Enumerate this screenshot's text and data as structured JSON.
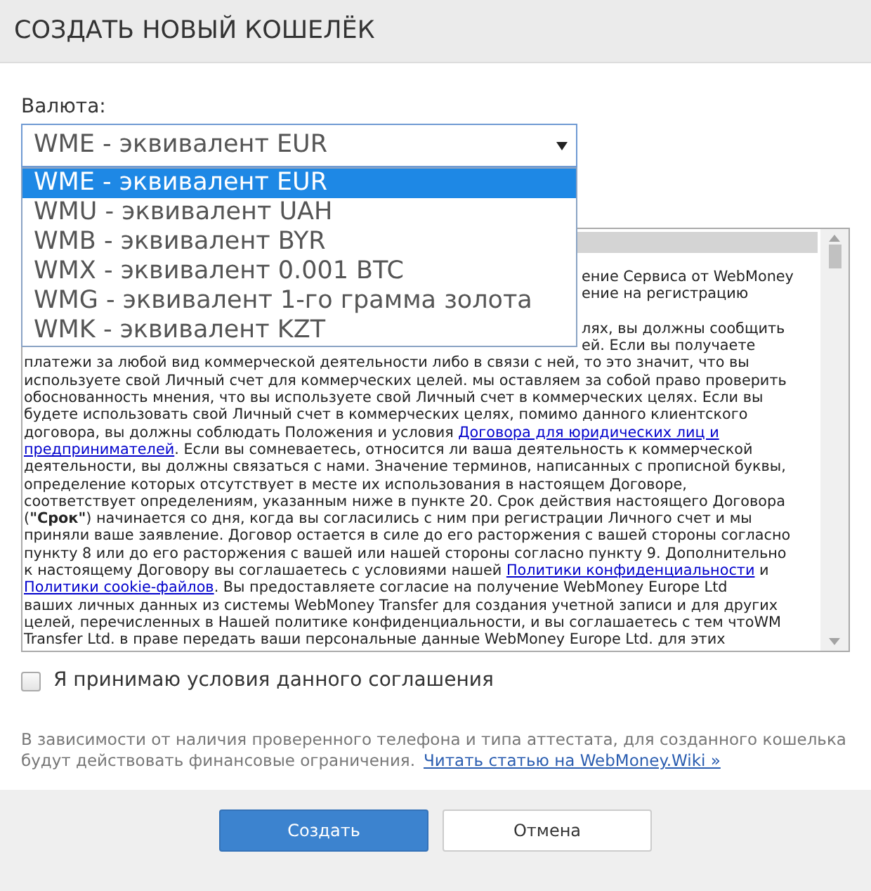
{
  "dialog": {
    "title": "СОЗДАТЬ НОВЫЙ КОШЕЛЁК"
  },
  "currency": {
    "label": "Валюта:",
    "value": "WME - эквивалент EUR",
    "expanded": true,
    "options": [
      {
        "text": "WME - эквивалент EUR",
        "selected": true
      },
      {
        "text": "WMU - эквивалент UAH",
        "selected": false
      },
      {
        "text": "WMB - эквивалент BYR",
        "selected": false
      },
      {
        "text": "WMX - эквивалент 0.001 BTC",
        "selected": false
      },
      {
        "text": "WMG - эквивалент 1-го грамма золота",
        "selected": false
      },
      {
        "text": "WMK - эквивалент KZT",
        "selected": false
      }
    ]
  },
  "agreement": {
    "paragraphs": [
      {
        "fragments": [
          "ение Сервиса от WebMoney",
          "ение на регистрацию"
        ]
      },
      {
        "fragments": [
          "лях, вы должны сообщить",
          "ей. Если вы получаете"
        ],
        "lines": [
          {
            "segments": [
              {
                "kind": "text",
                "text": "платежи за любой вид коммерческой деятельности либо в связи с ней, то это значит, что вы"
              }
            ]
          },
          {
            "segments": [
              {
                "kind": "text",
                "text": "используете свой Личный счет для коммерческих целей. мы оставляем за собой право проверить"
              }
            ]
          },
          {
            "segments": [
              {
                "kind": "text",
                "text": "обоснованность мнения, что вы используете свой Личный счет в коммерческих целях. Если вы"
              }
            ]
          },
          {
            "segments": [
              {
                "kind": "text",
                "text": "будете использовать свой Личный счет в коммерческих целях, помимо данного клиентского"
              }
            ]
          },
          {
            "segments": [
              {
                "kind": "text",
                "text": "договора, вы должны соблюдать Положения и условия "
              },
              {
                "kind": "link",
                "text": "Договора для юридических лиц и"
              }
            ]
          },
          {
            "segments": [
              {
                "kind": "link",
                "text": "предпринимателей"
              },
              {
                "kind": "text",
                "text": ". Если вы сомневаетесь, относится ли ваша деятельность к коммерческой"
              }
            ]
          },
          {
            "segments": [
              {
                "kind": "text",
                "text": "деятельности, вы должны связаться с нами. Значение терминов, написанных с прописной буквы,"
              }
            ]
          },
          {
            "segments": [
              {
                "kind": "text",
                "text": "определение которых отсутствует в месте их использования в настоящем Договоре,"
              }
            ]
          },
          {
            "segments": [
              {
                "kind": "text",
                "text": "соответствует определениям, указанным ниже в пункте 20. Срок действия настоящего Договора"
              }
            ]
          },
          {
            "segments": [
              {
                "kind": "text",
                "text": "("
              },
              {
                "kind": "bold",
                "text": "\"Срок\""
              },
              {
                "kind": "text",
                "text": ") начинается со дня, когда вы согласились с ним при регистрации Личного счет и мы"
              }
            ]
          },
          {
            "segments": [
              {
                "kind": "text",
                "text": "приняли ваше заявление. Договор остается в силе до его расторжения с вашей стороны согласно"
              }
            ]
          },
          {
            "segments": [
              {
                "kind": "text",
                "text": "пункту 8 или до его расторжения с вашей или нашей стороны согласно пункту 9. Дополнительно"
              }
            ]
          },
          {
            "segments": [
              {
                "kind": "text",
                "text": "к настоящему Договору вы соглашаетесь с условиями нашей "
              },
              {
                "kind": "link",
                "text": "Политики конфиденциальности"
              },
              {
                "kind": "text",
                "text": " и"
              }
            ]
          },
          {
            "segments": [
              {
                "kind": "link",
                "text": "Политики cookie-файлов"
              },
              {
                "kind": "text",
                "text": ". Вы предоставляете согласие на получение WebMoney Europe Ltd"
              }
            ]
          },
          {
            "segments": [
              {
                "kind": "text",
                "text": "ваших личных данных из системы WebMoney Transfer для создания учетной записи и для других"
              }
            ]
          },
          {
            "segments": [
              {
                "kind": "text",
                "text": "целей, перечисленных в Нашей политике конфиденциальности, и вы соглашаетесь с тем чтоWM"
              }
            ]
          },
          {
            "segments": [
              {
                "kind": "text",
                "text": "Transfer Ltd. в праве передать ваши персональные данные WebMoney Europe Ltd. для этих"
              }
            ]
          }
        ]
      }
    ]
  },
  "accept": {
    "label": "Я принимаю условия данного соглашения",
    "checked": false
  },
  "note": {
    "text": "В зависимости от наличия проверенного телефона и типа аттестата, для созданного кошелька будут действовать финансовые ограничения.",
    "link": "Читать статью на WebMoney.Wiki »"
  },
  "buttons": [
    {
      "kind": "primary",
      "label": "Создать"
    },
    {
      "kind": "secondary",
      "label": "Отмена"
    }
  ]
}
